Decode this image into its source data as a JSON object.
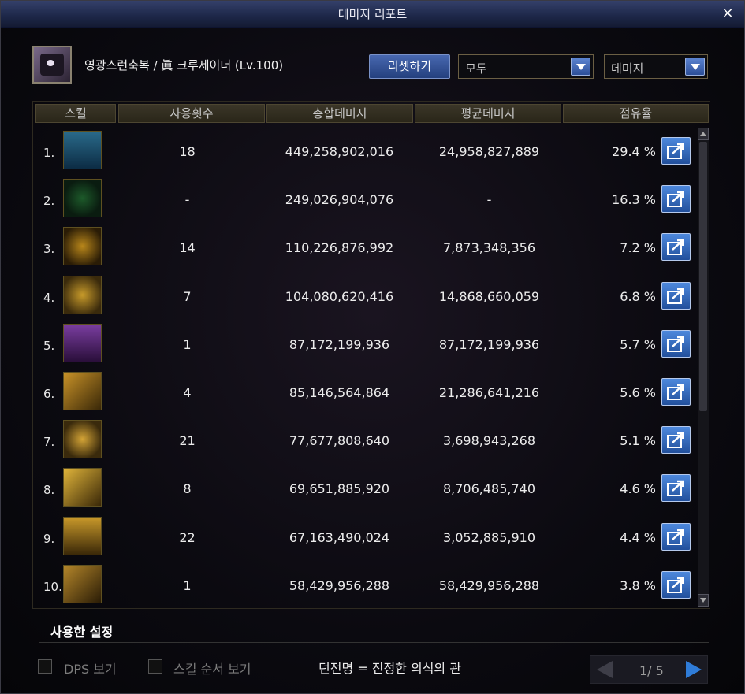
{
  "window": {
    "title": "데미지 리포트",
    "close_label": "×"
  },
  "character": {
    "name": "영광스런축복 / 眞 크루세이더 (Lv.100)"
  },
  "controls": {
    "reset_label": "리셋하기",
    "filter_value": "모두",
    "metric_value": "데미지"
  },
  "table": {
    "headers": [
      "스킬",
      "사용횟수",
      "총합데미지",
      "평균데미지",
      "점유율"
    ],
    "rows": [
      {
        "rank": "1.",
        "uses": "18",
        "total": "449,258,902,016",
        "avg": "24,958,827,889",
        "share": "29.4 %"
      },
      {
        "rank": "2.",
        "uses": "-",
        "total": "249,026,904,076",
        "avg": "-",
        "share": "16.3 %"
      },
      {
        "rank": "3.",
        "uses": "14",
        "total": "110,226,876,992",
        "avg": "7,873,348,356",
        "share": "7.2 %"
      },
      {
        "rank": "4.",
        "uses": "7",
        "total": "104,080,620,416",
        "avg": "14,868,660,059",
        "share": "6.8 %"
      },
      {
        "rank": "5.",
        "uses": "1",
        "total": "87,172,199,936",
        "avg": "87,172,199,936",
        "share": "5.7 %"
      },
      {
        "rank": "6.",
        "uses": "4",
        "total": "85,146,564,864",
        "avg": "21,286,641,216",
        "share": "5.6 %"
      },
      {
        "rank": "7.",
        "uses": "21",
        "total": "77,677,808,640",
        "avg": "3,698,943,268",
        "share": "5.1 %"
      },
      {
        "rank": "8.",
        "uses": "8",
        "total": "69,651,885,920",
        "avg": "8,706,485,740",
        "share": "4.6 %"
      },
      {
        "rank": "9.",
        "uses": "22",
        "total": "67,163,490,024",
        "avg": "3,052,885,910",
        "share": "4.4 %"
      },
      {
        "rank": "10.",
        "uses": "1",
        "total": "58,429,956,288",
        "avg": "58,429,956,288",
        "share": "3.8 %"
      }
    ]
  },
  "bottom": {
    "settings_tab": "사용한 설정",
    "dps_label": "DPS 보기",
    "skill_order_label": "스킬 순서 보기",
    "dungeon_text": "던전명 = 진정한 의식의 관",
    "page": "1/ 5"
  }
}
